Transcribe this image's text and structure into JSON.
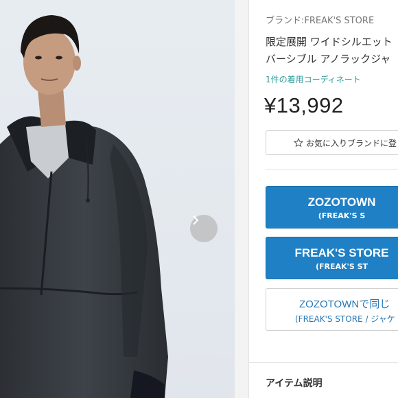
{
  "product": {
    "brand": "ブランド:FREAK'S STORE",
    "title_line1": "限定展開 ワイドシルエット",
    "title_line2": "バーシブル アノラックジャ",
    "coordinate_link": "1件の着用コーディネート",
    "price": "¥13,992"
  },
  "favorite_brand_button": {
    "label": "お気に入りブランドに登"
  },
  "cart_buttons": [
    {
      "main": "ZOZOTOWN",
      "sub": "(FREAK'S S"
    },
    {
      "main": "FREAK'S STORE",
      "sub": "(FREAK'S ST"
    }
  ],
  "same_item_button": {
    "main": "ZOZOTOWNで同じ",
    "sub": "(FREAK'S STORE / ジャケ"
  },
  "section": {
    "item_description": "アイテム説明"
  },
  "colors": {
    "primary_blue": "#1f80c5",
    "link_teal": "#2f9c9c",
    "outline_text": "#2678b6"
  },
  "icons": {
    "favorite": "star-outline-icon",
    "next": "chevron-right-icon"
  }
}
